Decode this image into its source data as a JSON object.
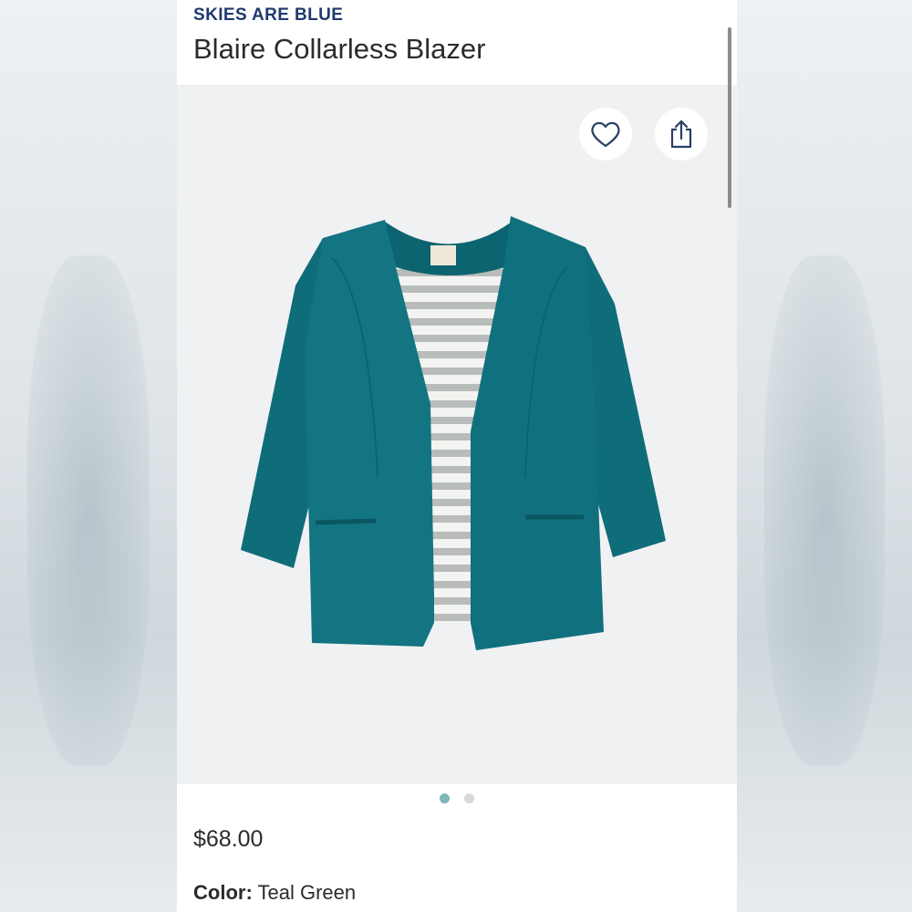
{
  "product": {
    "brand": "SKIES ARE BLUE",
    "title": "Blaire Collarless Blazer",
    "price": "$68.00",
    "color_label": "Color:",
    "color_value": "Teal Green"
  },
  "carousel": {
    "total": 2,
    "active_index": 0
  },
  "actions": {
    "favorite_icon": "heart-icon",
    "share_icon": "share-icon"
  },
  "colors": {
    "brand_text": "#1f3a6e",
    "jacket_teal": "#0f6f7b",
    "active_dot": "#7fb8b8",
    "inactive_dot": "#d6d8da"
  }
}
